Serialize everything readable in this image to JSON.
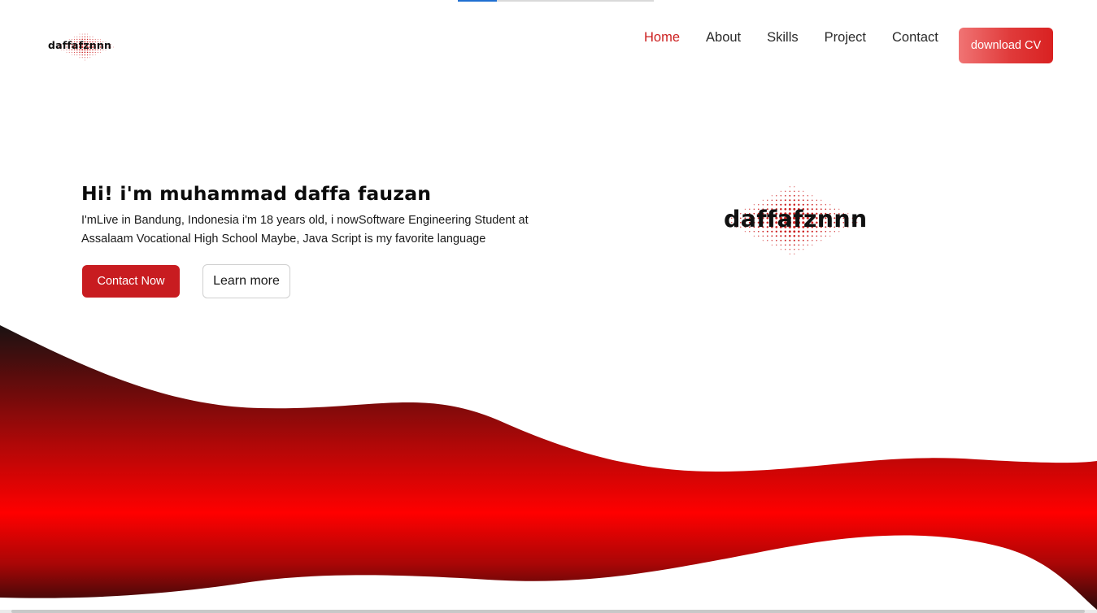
{
  "navbar": {
    "brand_text": "daffafznnn",
    "links": [
      {
        "label": "Home",
        "active": true
      },
      {
        "label": "About",
        "active": false
      },
      {
        "label": "Skills",
        "active": false
      },
      {
        "label": "Project",
        "active": false
      },
      {
        "label": "Contact",
        "active": false
      }
    ],
    "cv_button_label": "download CV"
  },
  "hero": {
    "title": "Hi! i'm muhammad daffa fauzan",
    "description": "I'mLive in Bandung, Indonesia i'm 18 years old, i nowSoftware Engineering Student at Assalaam Vocational High School Maybe, Java Script is my favorite language",
    "contact_button_label": "Contact Now",
    "learn_button_label": "Learn more",
    "logo_text": "daffafznnn"
  },
  "icons": {
    "brand_logo": "halftone-dot-logo-icon",
    "hero_logo": "halftone-dot-logo-icon"
  },
  "colors": {
    "accent": "#cc1f1f",
    "cv_gradient_start": "#f07474",
    "cv_gradient_end": "#d92121",
    "wave_dark": "#1a1212",
    "wave_red": "#ff0000",
    "active_link": "#cc1f1f"
  }
}
